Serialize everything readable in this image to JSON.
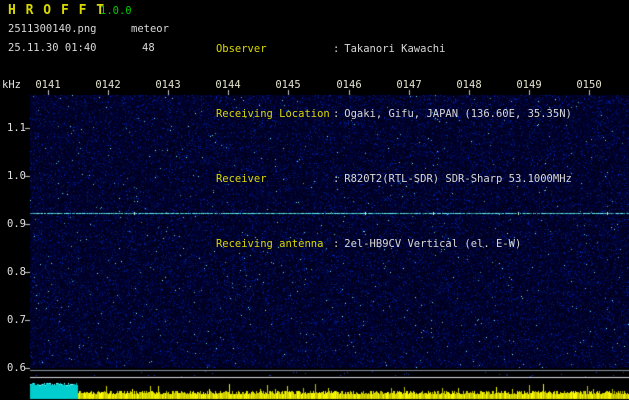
{
  "header": {
    "app_title": "H R O F F T",
    "version": "1.0.0",
    "filename": "2511300140.png",
    "mode": "meteor",
    "datetime": "25.11.30 01:40",
    "count": "48",
    "separator": ":",
    "info": [
      {
        "label": "Observer",
        "value": "Takanori Kawachi"
      },
      {
        "label": "Receiving Location",
        "value": "Ogaki, Gifu, JAPAN (136.60E, 35.35N)"
      },
      {
        "label": "Receiver",
        "value": "R820T2(RTL-SDR) SDR-Sharp 53.1000MHz"
      },
      {
        "label": "Receiving antenna",
        "value": "2el-HB9CV Vertical (el. E-W)"
      }
    ]
  },
  "chart_data": {
    "type": "heatmap",
    "ylabel": "kHz",
    "x_ticks": [
      "0141",
      "0142",
      "0143",
      "0144",
      "0145",
      "0146",
      "0147",
      "0148",
      "0149",
      "0150"
    ],
    "y_tick_labels": [
      "1.1",
      "1.0",
      "0.9",
      "0.8",
      "0.7",
      "0.6"
    ],
    "y_range_khz": [
      0.58,
      1.17
    ],
    "carrier_line_khz": 0.92,
    "grid": "off",
    "legend": "none",
    "background_noise": "dark blue random speckle spectrogram field",
    "signal_strip": {
      "description": "bottom signal-level strip with two horizontal reference lines, ragged yellow level bars, and a saturated cyan block at the start of the interval",
      "reference_lines": 2
    },
    "colors": {
      "noise_base": "#000033",
      "noise_speck": "#2244cc",
      "carrier": "#55e6e6",
      "bars": "#d8d800",
      "saturated": "#00cdcd",
      "axis_text": "#e0e0e0",
      "tick": "#c8c8c8"
    }
  }
}
